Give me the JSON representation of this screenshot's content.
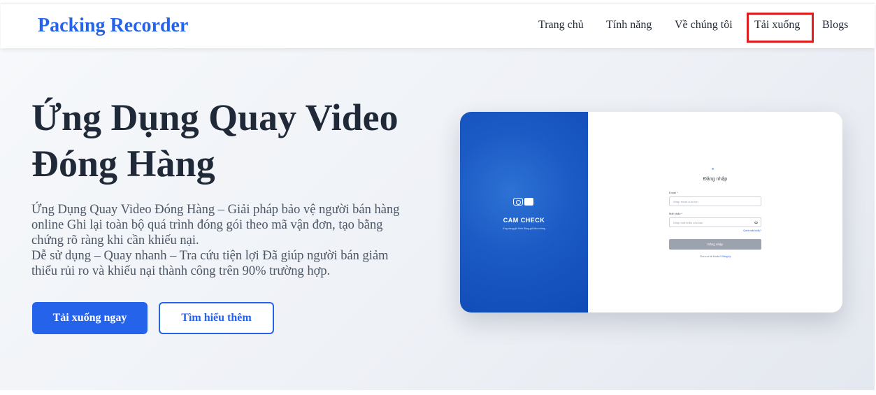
{
  "header": {
    "brand": "Packing Recorder",
    "nav": [
      {
        "label": "Trang chủ"
      },
      {
        "label": "Tính năng"
      },
      {
        "label": "Về chúng tôi"
      },
      {
        "label": "Tải xuống"
      },
      {
        "label": "Blogs"
      }
    ],
    "highlight_color": "#e01b1b"
  },
  "hero": {
    "title_line1": "Ứng Dụng Quay Video",
    "title_line2": "Đóng Hàng",
    "desc_line1": "Ứng Dụng Quay Video Đóng Hàng – Giải pháp bảo vệ người bán hàng",
    "desc_line2": "online Ghi lại toàn bộ quá trình đóng gói theo mã vận đơn, tạo bằng",
    "desc_line3": "chứng rõ ràng khi cần khiếu nại.",
    "desc_line4": "Dễ sử dụng – Quay nhanh – Tra cứu tiện lợi Đã giúp người bán giảm",
    "desc_line5": "thiểu rủi ro và khiếu nại thành công trên 90% trường hợp.",
    "primary_button": "Tải xuống ngay",
    "secondary_button": "Tìm hiểu thêm"
  },
  "preview": {
    "brand": "CAM CHECK",
    "brand_sub": "Ứng dụng ghi hình đóng gói bảo chứng",
    "login_title": "Đăng nhập",
    "email_label": "Email *",
    "email_placeholder": "Nhập email của bạn",
    "password_label": "Mật khẩu *",
    "password_placeholder": "Nhập mật khẩu của bạn",
    "forgot": "Quên mật khẩu?",
    "login_button": "Đăng nhập",
    "register_text": "Chưa có tài khoản?",
    "register_link": "Đăng ký"
  },
  "colors": {
    "accent": "#2563eb",
    "title": "#1f2937",
    "text": "#4b5563"
  }
}
